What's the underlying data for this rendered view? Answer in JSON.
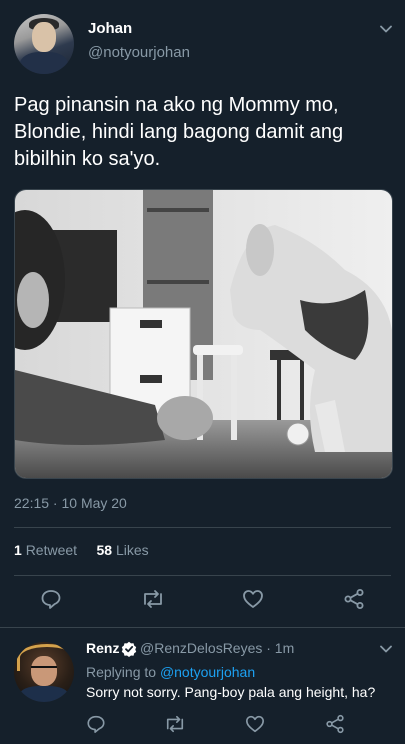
{
  "tweet": {
    "author_name": "Johan",
    "author_handle": "@notyourjohan",
    "text": "Pag pinansin na ako ng Mommy mo, Blondie, hindi lang bagong damit ang bibilhin ko sa'yo.",
    "time": "22:15 · 10 May 20",
    "retweets_count": "1",
    "retweets_label": "Retweet",
    "likes_count": "58",
    "likes_label": "Likes"
  },
  "reply": {
    "author_name": "Renz",
    "author_handle": "@RenzDelosReyes · 1m",
    "replying_to_prefix": "Replying to",
    "replying_to_handle": "@notyourjohan",
    "text": "Sorry not sorry. Pang-boy pala ang height, ha?"
  },
  "colors": {
    "background": "#15202b",
    "muted_text": "#8899a6",
    "link": "#1da1f2",
    "divider": "#38444d",
    "verified": "#ffffff"
  },
  "icons": {
    "actions": [
      "reply-icon",
      "retweet-icon",
      "like-icon",
      "share-icon"
    ],
    "menu": "chevron-down-icon",
    "verified": "verified-badge-icon"
  }
}
